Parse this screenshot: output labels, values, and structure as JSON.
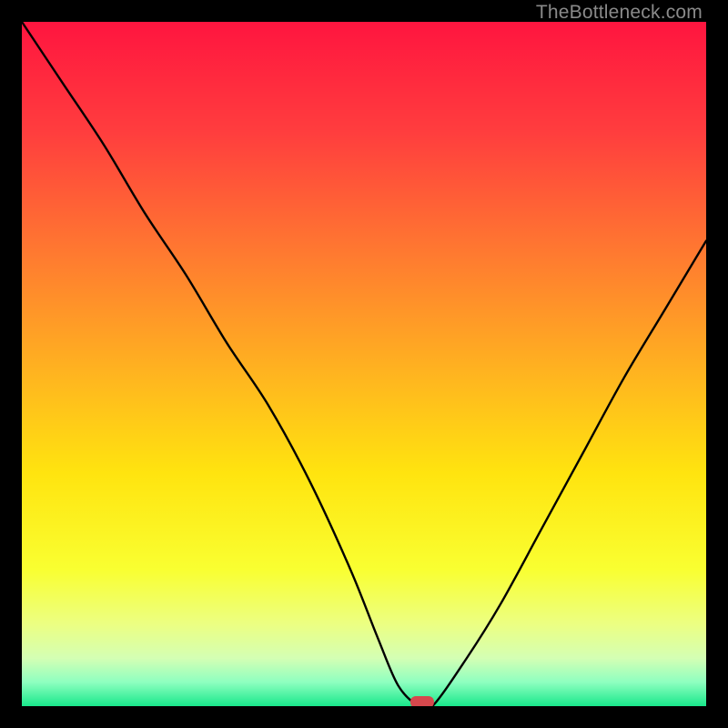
{
  "watermark": "TheBottleneck.com",
  "chart_data": {
    "type": "line",
    "title": "",
    "xlabel": "",
    "ylabel": "",
    "xlim": [
      0,
      100
    ],
    "ylim": [
      0,
      100
    ],
    "series": [
      {
        "name": "bottleneck-curve",
        "x": [
          0,
          6,
          12,
          18,
          24,
          30,
          36,
          42,
          48,
          52,
          55,
          58,
          60,
          65,
          70,
          76,
          82,
          88,
          94,
          100
        ],
        "y": [
          100,
          91,
          82,
          72,
          63,
          53,
          44,
          33,
          20,
          10,
          3,
          0,
          0,
          7,
          15,
          26,
          37,
          48,
          58,
          68
        ]
      }
    ],
    "marker": {
      "x": 58.5,
      "y": 0.6,
      "color": "#d6484d"
    },
    "background_gradient": {
      "stops": [
        {
          "pct": 0.0,
          "color": "#ff153f"
        },
        {
          "pct": 0.16,
          "color": "#ff3d3e"
        },
        {
          "pct": 0.34,
          "color": "#ff7a30"
        },
        {
          "pct": 0.52,
          "color": "#ffb61f"
        },
        {
          "pct": 0.66,
          "color": "#ffe40f"
        },
        {
          "pct": 0.8,
          "color": "#f9ff31"
        },
        {
          "pct": 0.88,
          "color": "#ecff82"
        },
        {
          "pct": 0.93,
          "color": "#d4ffb4"
        },
        {
          "pct": 0.965,
          "color": "#8effc0"
        },
        {
          "pct": 1.0,
          "color": "#19e88b"
        }
      ]
    }
  }
}
